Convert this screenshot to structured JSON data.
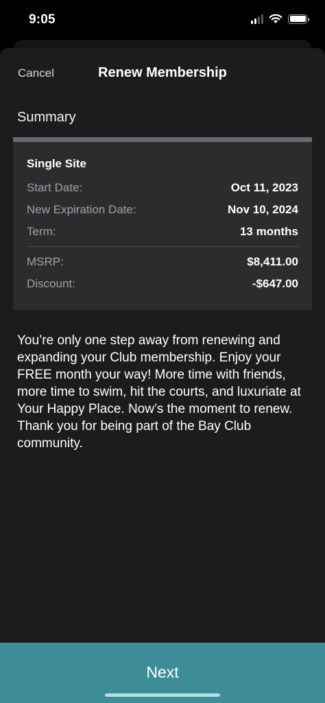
{
  "status_bar": {
    "time": "9:05"
  },
  "header": {
    "cancel_label": "Cancel",
    "title": "Renew Membership"
  },
  "summary": {
    "heading": "Summary",
    "plan": "Single Site",
    "rows": [
      {
        "label": "Start Date:",
        "value": "Oct 11, 2023"
      },
      {
        "label": "New Expiration Date:",
        "value": "Nov 10, 2024"
      },
      {
        "label": "Term:",
        "value": "13 months"
      }
    ],
    "pricing": [
      {
        "label": "MSRP:",
        "value": "$8,411.00"
      },
      {
        "label": "Discount:",
        "value": "-$647.00"
      }
    ]
  },
  "message": "You’re only one step away from renewing and expanding your Club membership. Enjoy your FREE month your way! More time with friends, more time to swim, hit the courts, and luxuriate at Your Happy Place. Now’s the moment to renew. Thank you for being part of the Bay Club community.",
  "footer": {
    "next_label": "Next"
  },
  "colors": {
    "accent": "#3d8c98",
    "background": "#1c1c1e",
    "card": "#2c2c2e"
  }
}
